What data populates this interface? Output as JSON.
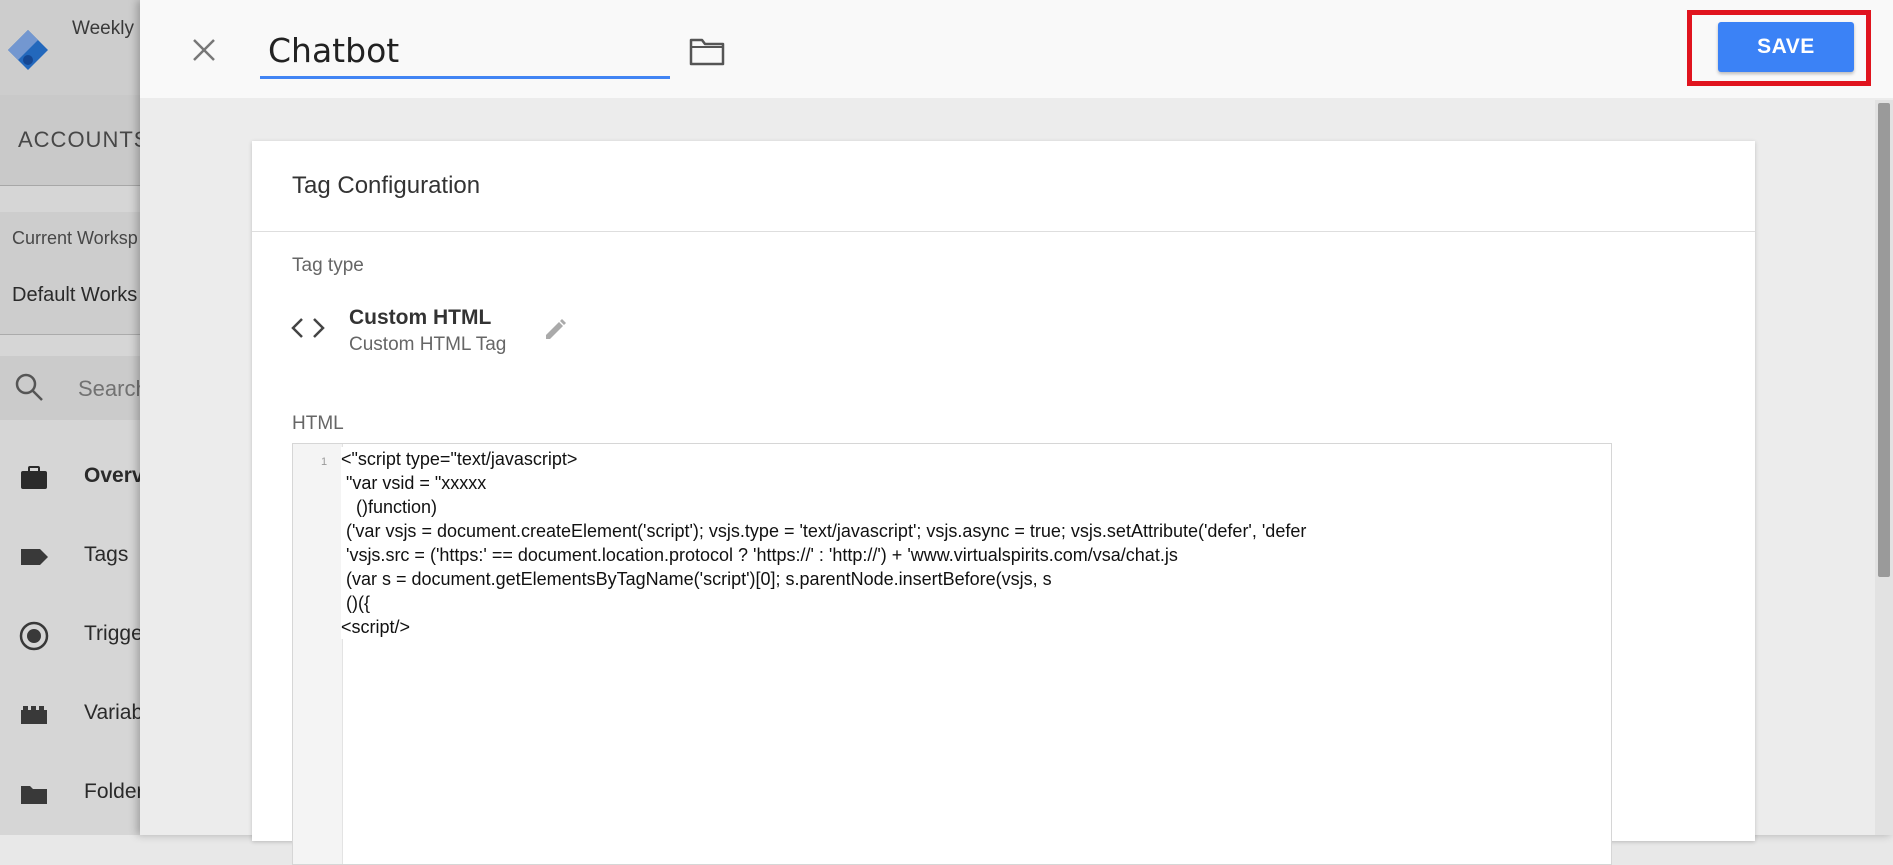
{
  "sidebar": {
    "workspace_title": "Weekly",
    "accounts_label": "ACCOUNTS",
    "current_workspace_label": "Current Worksp",
    "workspace_name": "Default Works",
    "search_placeholder": "Search",
    "nav": [
      {
        "label": "Overv",
        "icon": "briefcase-icon",
        "active": true
      },
      {
        "label": "Tags",
        "icon": "tag-icon",
        "active": false
      },
      {
        "label": "Trigge",
        "icon": "trigger-icon",
        "active": false
      },
      {
        "label": "Variab",
        "icon": "variables-icon",
        "active": false
      },
      {
        "label": "Folder",
        "icon": "folder-icon",
        "active": false
      }
    ]
  },
  "header": {
    "tag_name": "Chatbot",
    "save_label": "SAVE"
  },
  "card": {
    "title": "Tag Configuration",
    "tag_type_label": "Tag type",
    "tag_type_name": "Custom HTML",
    "tag_type_description": "Custom HTML Tag",
    "html_label": "HTML",
    "line_number": "1",
    "code_lines": [
      "<\"script type=\"text/javascript>",
      " \"var vsid = \"xxxxx",
      "   ()function)",
      " ('var vsjs = document.createElement('script'); vsjs.type = 'text/javascript'; vsjs.async = true; vsjs.setAttribute('defer', 'defer",
      " 'vsjs.src = ('https:' == document.location.protocol ? 'https://' : 'http://') + 'www.virtualspirits.com/vsa/chat.js",
      " (var s = document.getElementsByTagName('script')[0]; s.parentNode.insertBefore(vsjs, s",
      " ()({",
      "<script/>"
    ]
  },
  "colors": {
    "accent": "#4285f4",
    "save_button": "#3b82f6",
    "highlight_border": "#e0141e"
  }
}
